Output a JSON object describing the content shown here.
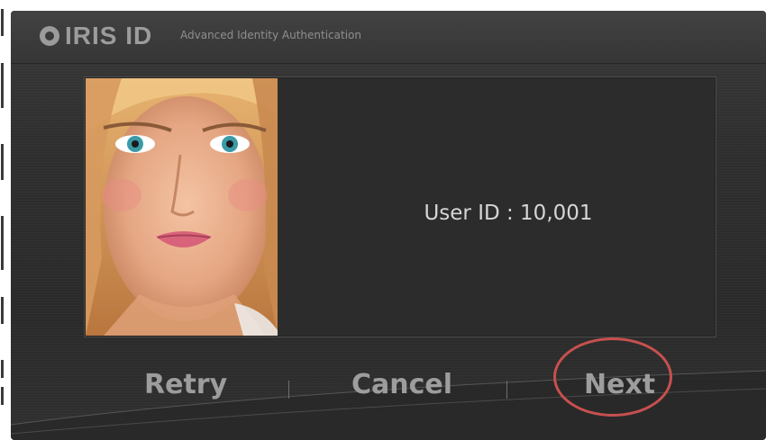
{
  "header": {
    "logo_text": "IRIS ID",
    "tagline": "Advanced Identity Authentication"
  },
  "main": {
    "photo_icon": "user-portrait",
    "user_id": "User ID : 10,001"
  },
  "buttons": {
    "retry": "Retry",
    "cancel": "Cancel",
    "next": "Next"
  },
  "colors": {
    "highlight": "#c7504f",
    "text_light": "#d6d6d6",
    "button_text": "#9d9d9d"
  }
}
